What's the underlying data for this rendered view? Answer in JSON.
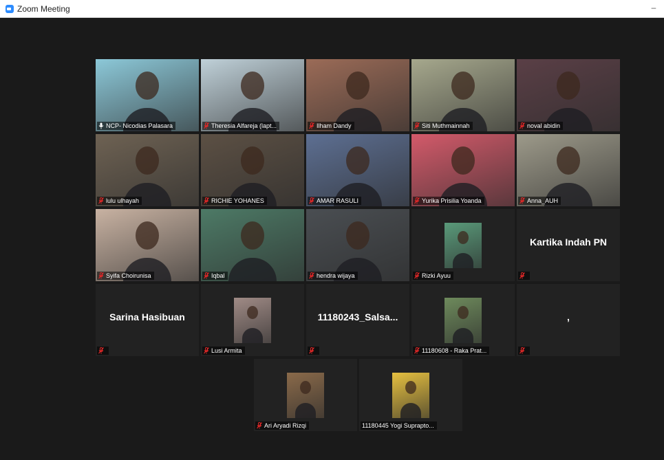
{
  "window": {
    "title": "Zoom Meeting",
    "minimize_label": "–"
  },
  "tiles": [
    {
      "name": "NCP- Nicodias Palasara",
      "kind": "video",
      "muted": false,
      "active": true,
      "bg": "#8cc8d8"
    },
    {
      "name": "Theresia Alfareja (lapt...",
      "kind": "video",
      "muted": true,
      "bg": "#bfd0d8"
    },
    {
      "name": "Ilham Dandy",
      "kind": "video",
      "muted": true,
      "bg": "#9b6b57"
    },
    {
      "name": "Siti Muthmainnah",
      "kind": "video",
      "muted": true,
      "bg": "#a6a88d"
    },
    {
      "name": "noval abidin",
      "kind": "video",
      "muted": true,
      "bg": "#5a3f46"
    },
    {
      "name": "lulu ulhayah",
      "kind": "video",
      "muted": true,
      "bg": "#6e6253"
    },
    {
      "name": "RICHIE YOHANES",
      "kind": "video",
      "muted": true,
      "bg": "#5c5044"
    },
    {
      "name": "AMAR RASULI",
      "kind": "video",
      "muted": true,
      "bg": "#5d6f92"
    },
    {
      "name": "Yurika Prisilia Yoanda",
      "kind": "video",
      "muted": true,
      "bg": "#d35a6a"
    },
    {
      "name": "Anna_AUH",
      "kind": "video",
      "muted": true,
      "bg": "#9d9a8a"
    },
    {
      "name": "Syifa Choirunisa",
      "kind": "video",
      "muted": true,
      "bg": "#c8b2a2"
    },
    {
      "name": "Iqbal",
      "kind": "video",
      "muted": true,
      "bg": "#4d7a66"
    },
    {
      "name": "hendra wijaya",
      "kind": "video",
      "muted": true,
      "bg": "#4a4e52"
    },
    {
      "name": "Rizki Ayuu",
      "kind": "photo",
      "muted": true,
      "bg": "#5a9a7a"
    },
    {
      "name": "",
      "display": "Kartika Indah PN",
      "kind": "text",
      "muted": true
    },
    {
      "name": "",
      "display": "Sarina Hasibuan",
      "kind": "text",
      "muted": true
    },
    {
      "name": "Lusi Armita",
      "kind": "photo",
      "muted": true,
      "bg": "#a08b86"
    },
    {
      "name": "",
      "display": "11180243_Salsa...",
      "kind": "text",
      "muted": true
    },
    {
      "name": "11180608 - Raka Prat...",
      "kind": "photo",
      "muted": true,
      "bg": "#6e8a5c"
    },
    {
      "name": "",
      "display": ",",
      "kind": "text",
      "muted": true
    },
    {
      "name": "Ari Aryadi Rizqi",
      "kind": "photo",
      "muted": true,
      "bg": "#8a6a4a"
    },
    {
      "name": "11180445 Yogi Suprapto...",
      "kind": "photo",
      "muted": false,
      "bg": "#e6c040"
    }
  ],
  "colors": {
    "active_border": "#c3e35b",
    "muted_icon": "#e02828",
    "background": "#1a1a1a",
    "tile": "#222222"
  }
}
